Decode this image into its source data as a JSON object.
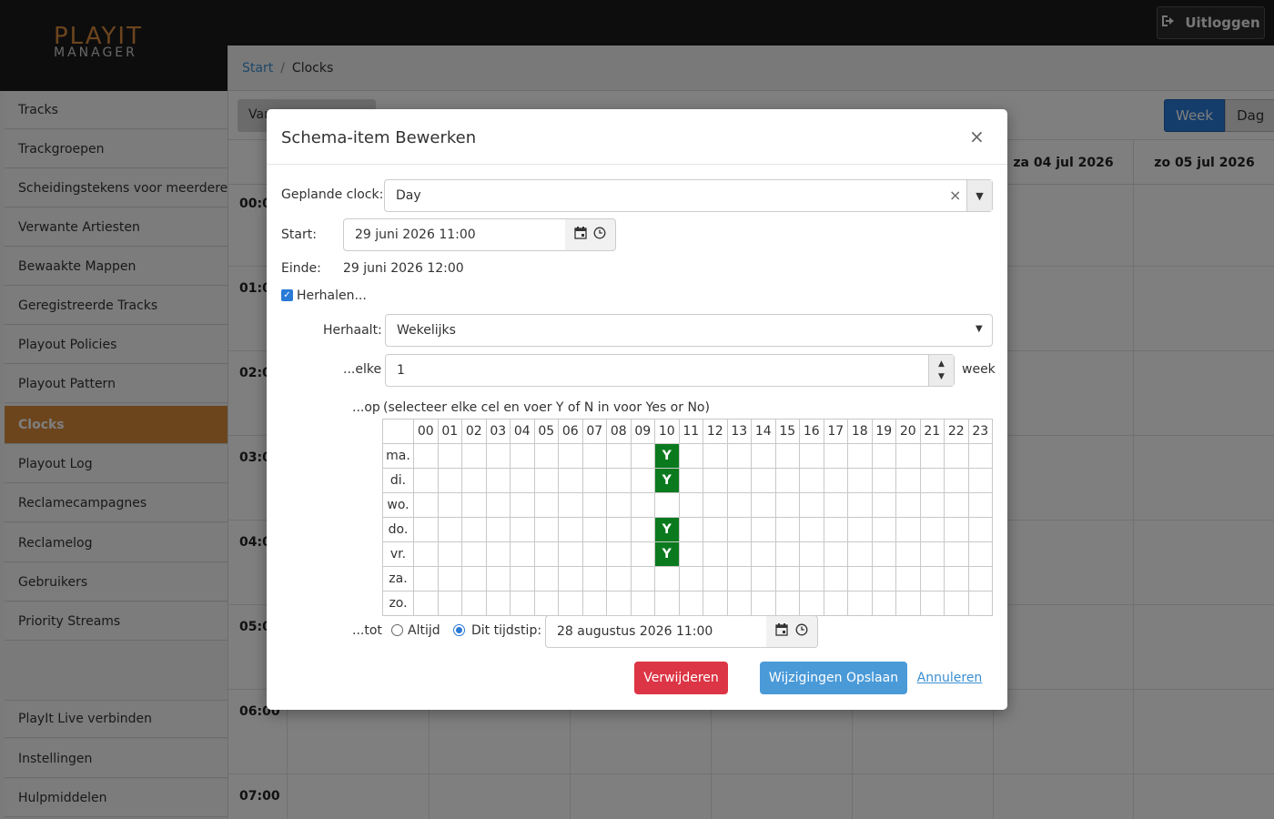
{
  "app": {
    "logo_line1": "PLAYIT",
    "logo_line2": "MANAGER",
    "logout_label": "Uitloggen"
  },
  "sidebar": {
    "items": [
      {
        "label": "Tracks"
      },
      {
        "label": "Trackgroepen"
      },
      {
        "label": "Scheidingstekens voor meerdere artiesten"
      },
      {
        "label": "Verwante Artiesten"
      },
      {
        "label": "Bewaakte Mappen"
      },
      {
        "label": "Geregistreerde Tracks"
      },
      {
        "label": "Playout Policies"
      },
      {
        "label": "Playout Pattern"
      },
      {
        "label": "Clocks",
        "active": true
      },
      {
        "label": "Playout Log"
      },
      {
        "label": "Reclamecampagnes"
      },
      {
        "label": "Reclamelog"
      },
      {
        "label": "Gebruikers"
      },
      {
        "label": "Priority Streams"
      }
    ],
    "bottom_items": [
      {
        "label": "PlayIt Live verbinden"
      },
      {
        "label": "Instellingen"
      },
      {
        "label": "Hulpmiddelen"
      }
    ]
  },
  "breadcrumb": {
    "home": "Start",
    "separator": "/",
    "current": "Clocks"
  },
  "calendar": {
    "toolbar_left": "Van",
    "view_week": "Week",
    "view_day": "Dag",
    "day_headers": [
      "za 04 jul 2026",
      "zo 05 jul 2026"
    ],
    "times": [
      "00:0",
      "01:0",
      "02:0",
      "03:0",
      "04:0",
      "05:0",
      "06:00",
      "07:00"
    ]
  },
  "modal": {
    "title": "Schema-item Bewerken",
    "close": "×",
    "clock_label": "Geplande clock:",
    "clock_value": "Day",
    "start_label": "Start:",
    "start_value": "29 juni 2026 11:00",
    "end_label": "Einde:",
    "end_value": "29 juni 2026 12:00",
    "repeat_label": "Herhalen...",
    "repeat_checked": true,
    "repeats_label": "Herhaalt:",
    "repeats_value": "Wekelijks",
    "every_label": "...elke",
    "every_value": "1",
    "every_unit": "week",
    "on_label": "...op",
    "on_hint": "(selecteer elke cel en voer Y of N in voor Yes or No)",
    "hours": [
      "00",
      "01",
      "02",
      "03",
      "04",
      "05",
      "06",
      "07",
      "08",
      "09",
      "10",
      "11",
      "12",
      "13",
      "14",
      "15",
      "16",
      "17",
      "18",
      "19",
      "20",
      "21",
      "22",
      "23"
    ],
    "days": [
      "ma.",
      "di.",
      "wo.",
      "do.",
      "vr.",
      "za.",
      "zo."
    ],
    "selected": [
      {
        "day": "ma.",
        "hour": "10",
        "value": "Y"
      },
      {
        "day": "di.",
        "hour": "10",
        "value": "Y"
      },
      {
        "day": "do.",
        "hour": "10",
        "value": "Y"
      },
      {
        "day": "vr.",
        "hour": "10",
        "value": "Y"
      }
    ],
    "until_label": "...tot",
    "always_label": "Altijd",
    "at_time_label": "Dit tijdstip:",
    "until_choice": "Dit tijdstip:",
    "until_value": "28 augustus 2026 11:00",
    "delete_label": "Verwijderen",
    "save_label": "Wijzigingen Opslaan",
    "cancel_label": "Annuleren"
  },
  "colors": {
    "brand": "#d98a3a",
    "selected_cell": "#0b7a1e",
    "primary": "#4a9ad8",
    "danger": "#dc3545"
  }
}
